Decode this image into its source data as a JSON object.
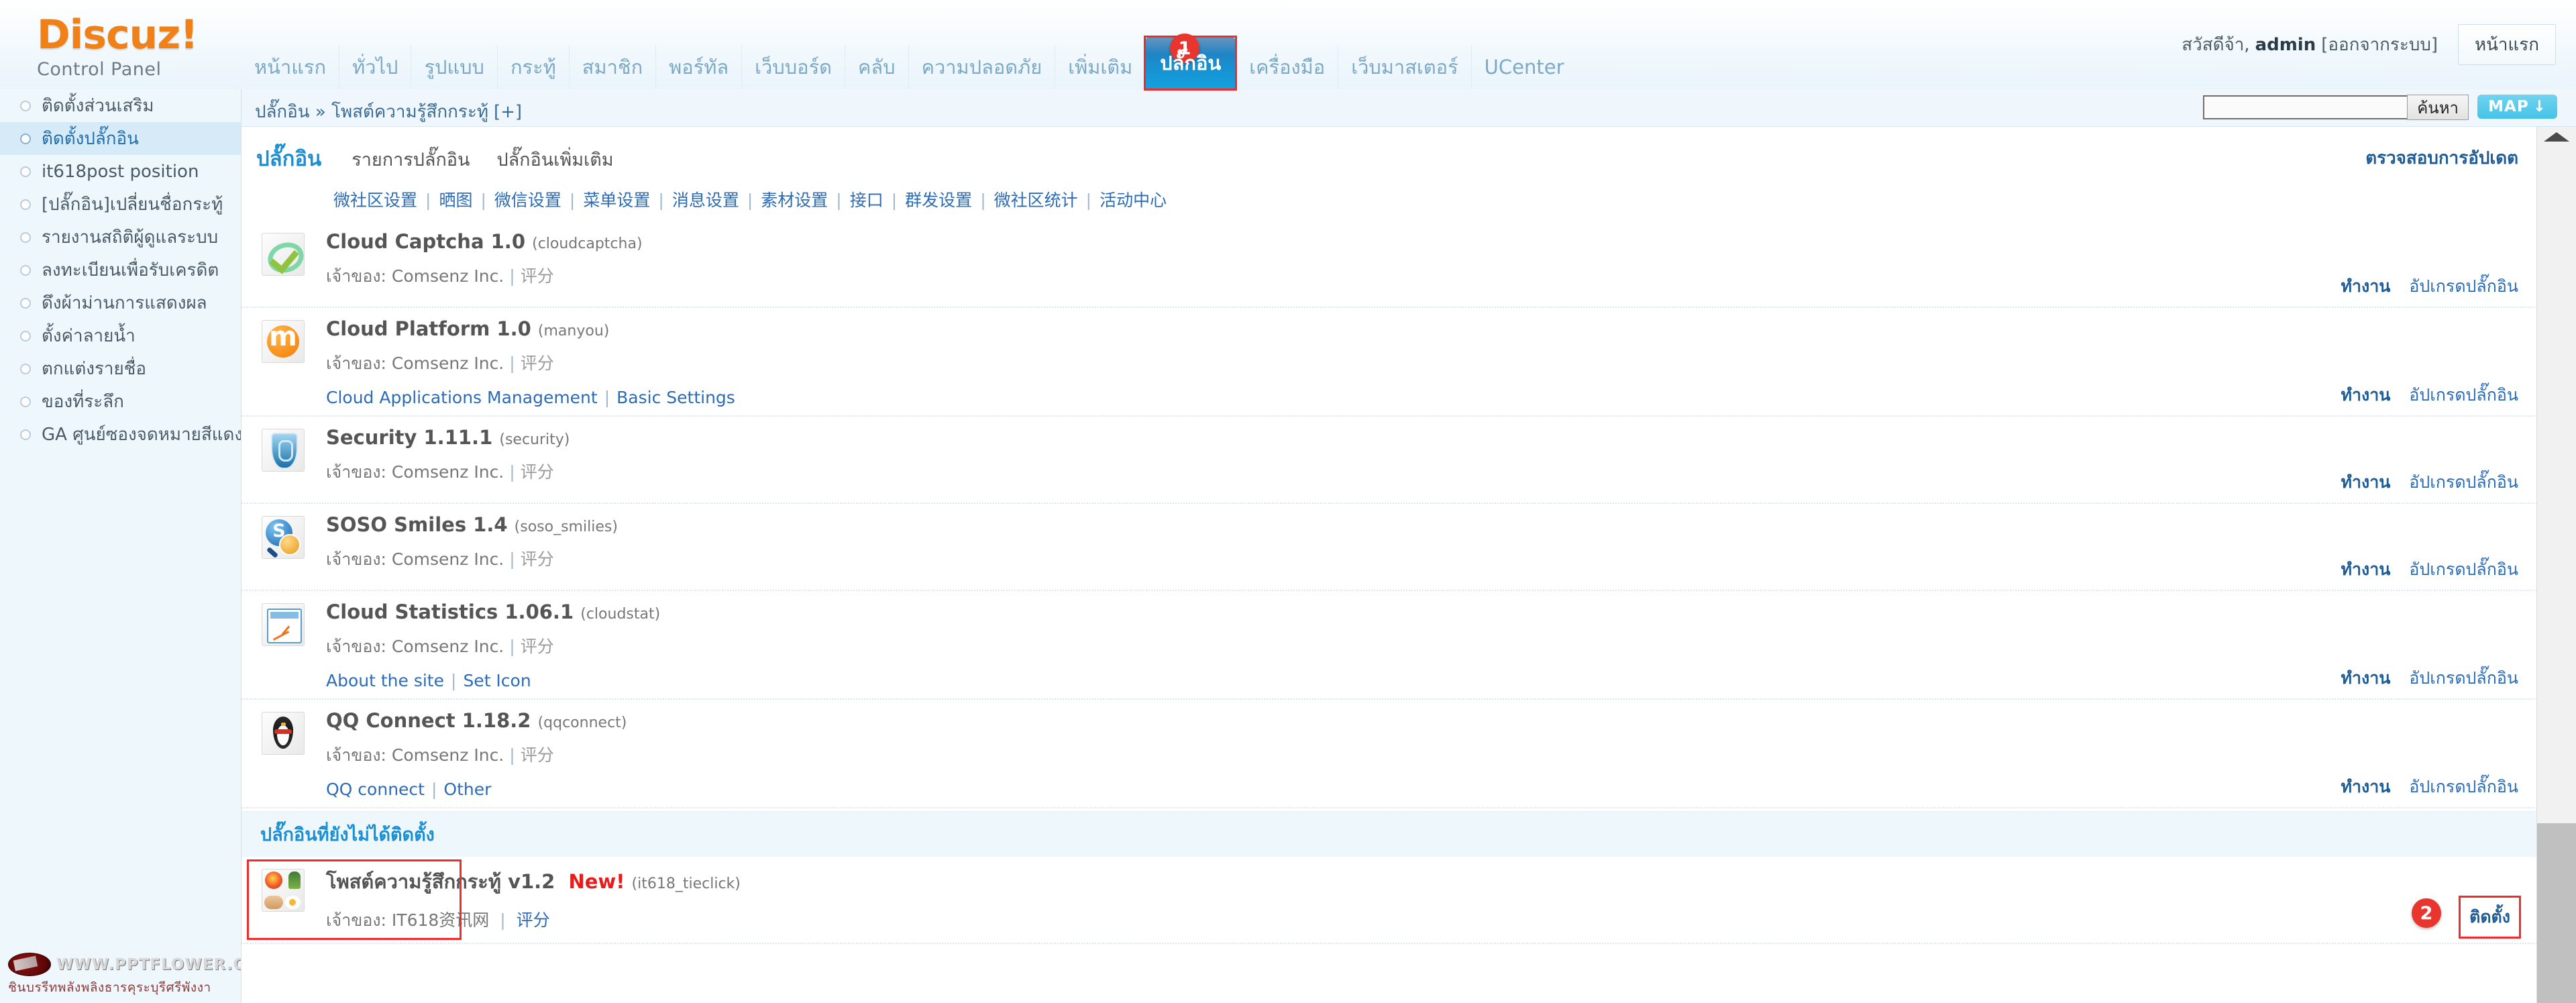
{
  "brand": {
    "name": "Discuz!",
    "subtitle": "Control Panel"
  },
  "topnav": {
    "items": [
      {
        "label": "หน้าแรก",
        "active": false
      },
      {
        "label": "ทั่วไป",
        "active": false
      },
      {
        "label": "รูปแบบ",
        "active": false
      },
      {
        "label": "กระทู้",
        "active": false
      },
      {
        "label": "สมาชิก",
        "active": false
      },
      {
        "label": "พอร์ทัล",
        "active": false
      },
      {
        "label": "เว็บบอร์ด",
        "active": false
      },
      {
        "label": "คลับ",
        "active": false
      },
      {
        "label": "ความปลอดภัย",
        "active": false
      },
      {
        "label": "เพิ่มเติม",
        "active": false
      },
      {
        "label": "ปลั๊กอิน",
        "active": true
      },
      {
        "label": "เครื่องมือ",
        "active": false
      },
      {
        "label": "เว็บมาสเตอร์",
        "active": false
      },
      {
        "label": "UCenter",
        "active": false
      }
    ]
  },
  "userbar": {
    "greeting": "สวัสดีจ้า,",
    "username": "admin",
    "logout": "[ออกจากระบบ]",
    "home_button": "หน้าแรก"
  },
  "breadcrumb": {
    "text": "ปลั๊กอิน » โพสต์ความรู้สึกกระทู้",
    "expand": "[+]"
  },
  "search": {
    "value": "",
    "placeholder": "",
    "button": "ค้นหา",
    "map_button": "MAP",
    "map_icon": "arrow-down-icon"
  },
  "sidebar": {
    "items": [
      {
        "label": "ติดตั้งส่วนเสริม",
        "active": false
      },
      {
        "label": "ติดตั้งปลั๊กอิน",
        "active": true
      },
      {
        "label": "it618post position",
        "active": false
      },
      {
        "label": "[ปลั๊กอิน]เปลี่ยนชื่อกระทู้",
        "active": false
      },
      {
        "label": "รายงานสถิติผู้ดูแลระบบ",
        "active": false
      },
      {
        "label": "ลงทะเบียนเพื่อรับเครดิต",
        "active": false
      },
      {
        "label": "ดึงผ้าม่านการแสดงผล",
        "active": false
      },
      {
        "label": "ตั้งค่าลายน้ำ",
        "active": false
      },
      {
        "label": "ตกแต่งรายชื่อ",
        "active": false
      },
      {
        "label": "ของที่ระลึก",
        "active": false
      },
      {
        "label": "GA ศูนย์ซองจดหมายสีแดง",
        "active": false
      }
    ]
  },
  "watermark": {
    "url": "WWW.PPTFLOWER.COM",
    "subtitle": "ชินบรรีทพลังพลิงธารคุระบุรีศรีพังงา"
  },
  "main": {
    "title": "ปลั๊กอิน",
    "tabs": [
      {
        "label": "รายการปลั๊กอิน"
      },
      {
        "label": "ปลั๊กอินเพิ่มเติม"
      }
    ],
    "check_update": "ตรวจสอบการอัปเดต",
    "sublinks": [
      "微社区设置",
      "晒图",
      "微信设置",
      "菜单设置",
      "消息设置",
      "素材设置",
      "接口",
      "群发设置",
      "微社区统计",
      "活动中心"
    ],
    "owner_label": "เจ้าของ:",
    "rate_label": "评分",
    "action_run": "ทำงาน",
    "action_upgrade": "อัปเกรดปลั๊กอิน",
    "plugins": [
      {
        "name": "Cloud Captcha 1.0",
        "id": "(cloudcaptcha)",
        "owner": "Comsenz Inc.",
        "icon": "cloud-captcha-icon",
        "links": []
      },
      {
        "name": "Cloud Platform 1.0",
        "id": "(manyou)",
        "owner": "Comsenz Inc.",
        "icon": "cloud-platform-icon",
        "links": [
          "Cloud Applications Management",
          "Basic Settings"
        ]
      },
      {
        "name": "Security 1.11.1",
        "id": "(security)",
        "owner": "Comsenz Inc.",
        "icon": "security-shield-icon",
        "links": []
      },
      {
        "name": "SOSO Smiles 1.4",
        "id": "(soso_smilies)",
        "owner": "Comsenz Inc.",
        "icon": "soso-smiles-icon",
        "links": []
      },
      {
        "name": "Cloud Statistics 1.06.1",
        "id": "(cloudstat)",
        "owner": "Comsenz Inc.",
        "icon": "cloud-statistics-icon",
        "links": [
          "About the site",
          "Set Icon"
        ]
      },
      {
        "name": "QQ Connect 1.18.2",
        "id": "(qqconnect)",
        "owner": "Comsenz Inc.",
        "icon": "qq-penguin-icon",
        "links": [
          "QQ connect",
          "Other"
        ]
      }
    ],
    "uninstalled_heading": "ปลั๊กอินที่ยังไม่ได้ติดตั้ง",
    "uninstalled": {
      "name": "โพสต์ความรู้สึกกระทู้ v1.2",
      "new_badge": "New!",
      "id": "(it618_tieclick)",
      "owner": "IT618资讯网",
      "rate_label": "评分",
      "icon": "flower-handshake-icon",
      "install_label": "ติดตั้ง"
    }
  },
  "annotations": {
    "badge_one": "1",
    "badge_two": "2",
    "color": "#ef2b2b"
  }
}
